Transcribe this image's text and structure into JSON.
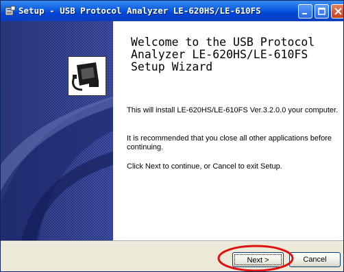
{
  "window": {
    "title": "Setup - USB Protocol Analyzer LE-620HS/LE-610FS"
  },
  "titlebar": {
    "icons": [
      "setup-app-icon",
      "minimize-icon",
      "maximize-icon",
      "close-icon"
    ]
  },
  "content": {
    "heading": "Welcome to the USB Protocol Analyzer LE-620HS/LE-610FS Setup Wizard",
    "paragraph1": "This will install LE-620HS/LE-610FS Ver.3.2.0.0 your computer.",
    "paragraph2": "It is recommended that you close all other applications before continuing.",
    "paragraph3": "Click Next to continue, or Cancel to exit Setup."
  },
  "buttons": {
    "next_label": "Next >",
    "cancel_label": "Cancel"
  },
  "colors": {
    "titlebar": "#0a5be0",
    "sidebar": "#2c3a85",
    "annotation": "#e01010",
    "button_face": "#f0efe6"
  }
}
